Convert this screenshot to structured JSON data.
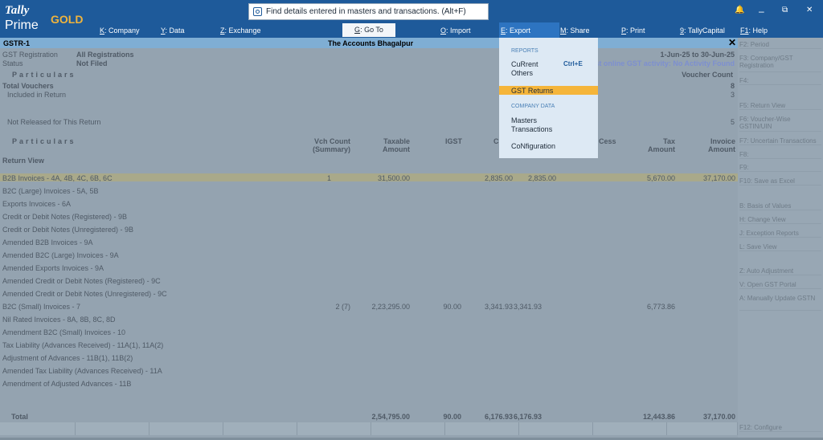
{
  "app": {
    "brand_top": "Tally",
    "brand_edition": "GOLD",
    "brand_bottom": "Prime"
  },
  "search": {
    "text": "Find details entered in masters and transactions. (Alt+F)"
  },
  "window_controls": {
    "notify": "🔔",
    "minimize": "–",
    "restore": "⧉",
    "close": "✕"
  },
  "menu": {
    "company": "Company",
    "company_key": "K",
    "data": "Data",
    "data_key": "Y",
    "exchange": "Exchange",
    "exchange_key": "Z",
    "goto": "Go To",
    "goto_key": "G",
    "import": "Import",
    "import_key": "O",
    "export": "Export",
    "export_key": "E",
    "share": "Share",
    "share_key": "M",
    "print": "Print",
    "print_key": "P",
    "tallycapital": "TallyCapital",
    "tallycapital_key": "9",
    "help": "Help",
    "help_key": "F1"
  },
  "titlebar": {
    "left": "GSTR-1",
    "center": "The Accounts Bhagalpur",
    "close": "✕"
  },
  "header": {
    "gst_reg_label": "GST Registration",
    "gst_reg_value": "All Registrations",
    "status_label": "Status",
    "status_value": "Not Filed",
    "period": "1-Jun-25 to 30-Jun-25",
    "last_activity": "Last online GST activity: No Activity Found"
  },
  "summary": {
    "particulars": "Particulars",
    "voucher_count": "Voucher Count",
    "total_vouchers": "Total Vouchers",
    "total_vouchers_value": "8",
    "included": "Included in Return",
    "included_value": "3",
    "not_released": "Not Released for This Return",
    "not_released_value": "5"
  },
  "table": {
    "col_particulars": "Particulars",
    "col_vch_count": "Vch Count",
    "col_vch_count_sub": "(Summary)",
    "col_taxable": "Taxable",
    "col_taxable_sub": "Amount",
    "col_igst": "IGST",
    "col_cgst": "C",
    "col_cess": "Cess",
    "col_tax": "Tax",
    "col_tax_sub": "Amount",
    "col_invoice": "Invoice",
    "col_invoice_sub": "Amount",
    "return_view": "Return View",
    "rows": [
      {
        "name": "B2B Invoices - 4A, 4B, 4C, 6B, 6C",
        "vch": "1",
        "taxable": "31,500.00",
        "igst": "",
        "cgst": "2,835.00",
        "sgst": "2,835.00",
        "tax": "5,670.00",
        "invoice": "37,170.00"
      },
      {
        "name": "B2C (Large) Invoices - 5A, 5B"
      },
      {
        "name": "Exports Invoices - 6A"
      },
      {
        "name": "Credit or Debit Notes (Registered) - 9B"
      },
      {
        "name": "Credit or Debit Notes (Unregistered) - 9B"
      },
      {
        "name": "Amended B2B Invoices - 9A"
      },
      {
        "name": "Amended B2C (Large) Invoices - 9A"
      },
      {
        "name": "Amended Exports Invoices - 9A"
      },
      {
        "name": "Amended Credit or Debit Notes (Registered) - 9C"
      },
      {
        "name": "Amended Credit or Debit Notes (Unregistered) - 9C"
      },
      {
        "name": "B2C (Small) Invoices - 7",
        "vch": "2   (7)",
        "taxable": "2,23,295.00",
        "igst": "90.00",
        "cgst": "3,341.93",
        "sgst": "3,341.93",
        "tax": "6,773.86"
      },
      {
        "name": "Nil Rated Invoices - 8A, 8B, 8C, 8D"
      },
      {
        "name": "Amendment B2C (Small) Invoices - 10"
      },
      {
        "name": "Tax Liability (Advances Received) - 11A(1), 11A(2)"
      },
      {
        "name": "Adjustment of Advances - 11B(1), 11B(2)"
      },
      {
        "name": "Amended Tax Liability (Advances Received) - 11A"
      },
      {
        "name": "Amendment of Adjusted Advances - 11B"
      }
    ],
    "total_label": "Total",
    "total_taxable": "2,54,795.00",
    "total_igst": "90.00",
    "total_cgst": "6,176.93",
    "total_sgst": "6,176.93",
    "total_tax": "12,443.86",
    "total_invoice": "37,170.00"
  },
  "rightbar": {
    "items": [
      "F2: Period",
      "F3: Company/GST Registration",
      "F4:",
      "F5: Return View",
      "F6: Voucher-Wise GSTIN/UIN",
      "F7: Uncertain Transactions",
      "F8:",
      "F9:",
      "F10: Save as Excel",
      "B: Basis of Values",
      "H: Change View",
      "J: Exception Reports",
      "L: Save View",
      "Z: Auto Adjustment",
      "V: Open GST Portal",
      "A: Manually Update GSTN",
      "F12: Configure"
    ]
  },
  "dropdown": {
    "reports_head": "REPORTS",
    "current": "CuRrent",
    "current_shortcut": "Ctrl+E",
    "others": "Others",
    "gst_returns": "GST Returns",
    "company_head": "COMPANY DATA",
    "masters": "Masters",
    "transactions": "Transactions",
    "configuration": "CoNfiguration"
  }
}
